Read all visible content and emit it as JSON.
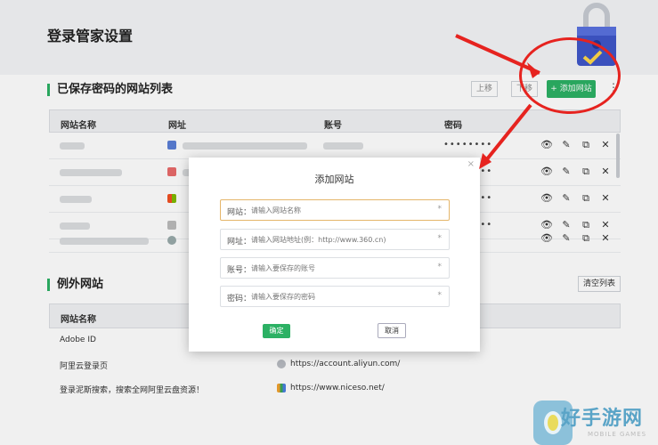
{
  "page": {
    "title": "登录管家设置"
  },
  "saved": {
    "title": "已保存密码的网站列表",
    "buttons": {
      "up": "上移",
      "down": "下移",
      "add": "+ 添加网站"
    },
    "columns": [
      "网站名称",
      "网址",
      "账号",
      "密码"
    ],
    "rows": [
      {
        "password": "••••••••"
      },
      {
        "password": "••••••••"
      },
      {
        "password": "••••••••"
      },
      {
        "password": "••••••••"
      },
      {
        "password": "••••••••"
      }
    ],
    "actions": {
      "view": "👁",
      "edit": "✎",
      "open": "⧉",
      "delete": "✕"
    }
  },
  "exceptions": {
    "title": "例外网站",
    "clear_label": "清空列表",
    "columns": [
      "网站名称"
    ],
    "rows": [
      {
        "name": "Adobe ID",
        "url": ""
      },
      {
        "name": "阿里云登录页",
        "url": "https://account.aliyun.com/"
      },
      {
        "name": "登录泥斯搜索，搜索全网阿里云盘资源！",
        "url": "https://www.niceso.net/"
      }
    ]
  },
  "modal": {
    "title": "添加网站",
    "close": "×",
    "fields": [
      {
        "label": "网站：",
        "placeholder": "请输入网站名称",
        "required": "*"
      },
      {
        "label": "网址：",
        "placeholder": "请输入网站地址(例：http://www.360.cn)",
        "required": "*"
      },
      {
        "label": "账号：",
        "placeholder": "请输入要保存的账号",
        "required": "*"
      },
      {
        "label": "密码：",
        "placeholder": "请输入要保存的密码",
        "required": "*"
      }
    ],
    "ok_label": "确定",
    "cancel_label": "取消"
  },
  "watermark": {
    "text": "好手游网",
    "sub": "MOBILE GAMES"
  },
  "colors": {
    "accent": "#2cb164",
    "annotation_red": "#e6231f"
  }
}
